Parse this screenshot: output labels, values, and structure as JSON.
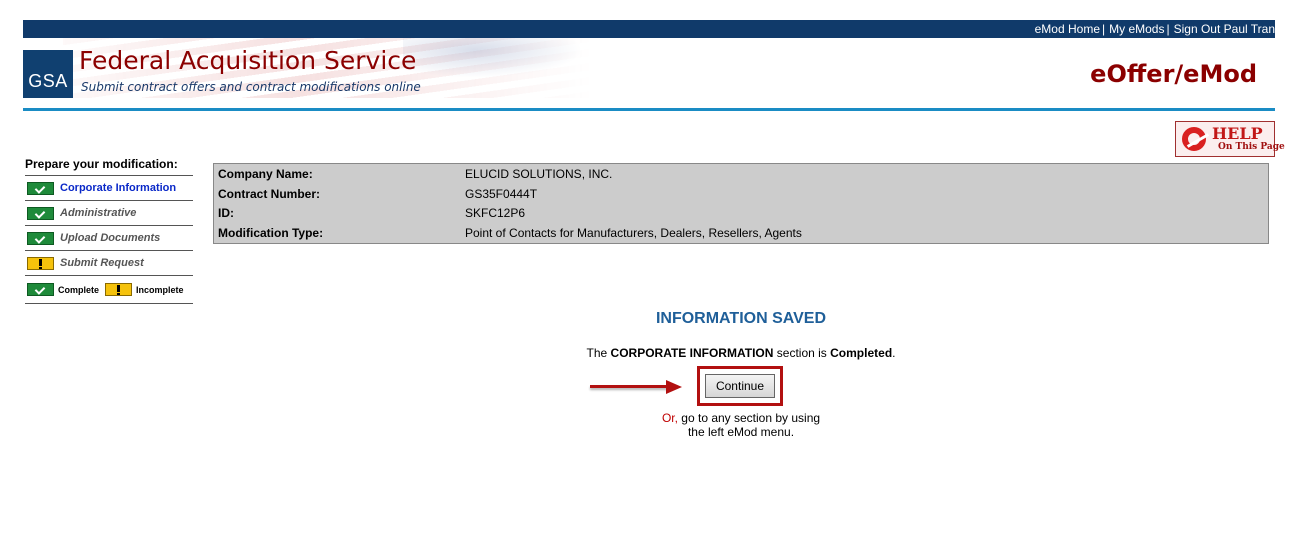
{
  "top_nav": {
    "links": [
      "eMod Home",
      "My eMods",
      "Sign Out Paul Tran"
    ],
    "separator": "|"
  },
  "header": {
    "logo_text": "GSA",
    "title": "Federal Acquisition Service",
    "subtitle": "Submit contract offers and contract modifications online",
    "app_name": "eOffer/eMod",
    "colors": {
      "nav_bar": "#103a6a",
      "title": "#8b0000",
      "rule": "#1a8cc4"
    }
  },
  "help": {
    "label": "HELP",
    "sublabel": "On This Page",
    "icon": "life-ring-icon"
  },
  "sidebar": {
    "heading": "Prepare your modification:",
    "items": [
      {
        "label": "Corporate Information",
        "status": "complete"
      },
      {
        "label": "Administrative",
        "status": "complete"
      },
      {
        "label": "Upload Documents",
        "status": "complete"
      },
      {
        "label": "Submit Request",
        "status": "incomplete"
      }
    ],
    "legend": {
      "complete": "Complete",
      "incomplete": "Incomplete"
    }
  },
  "info": {
    "company_label": "Company Name:",
    "company_value": "ELUCID SOLUTIONS, INC.",
    "contract_label": "Contract Number:",
    "contract_value": "GS35F0444T",
    "id_label": "ID:",
    "id_value": "SKFC12P6",
    "mod_type_label": "Modification Type:",
    "mod_type_value": "Point of Contacts for Manufacturers, Dealers, Resellers, Agents"
  },
  "saved": {
    "title": "INFORMATION SAVED",
    "msg_prefix": "The",
    "msg_section": "CORPORATE INFORMATION",
    "msg_middle": "section is",
    "msg_status": "Completed",
    "msg_end": ".",
    "continue_label": "Continue",
    "or_label": "Or,",
    "or_line1": "go to any section by using",
    "or_line2": "the left eMod menu."
  }
}
